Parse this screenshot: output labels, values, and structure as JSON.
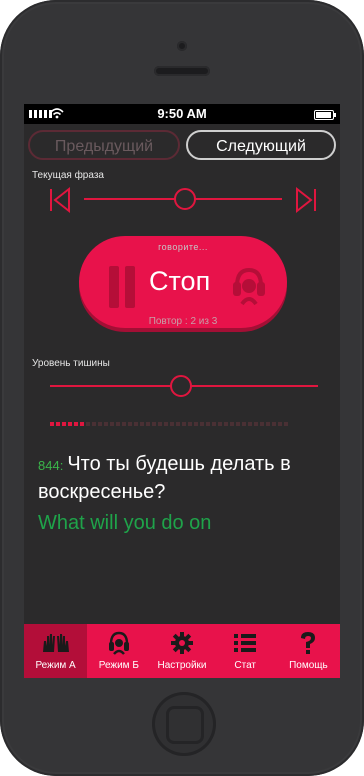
{
  "status_bar": {
    "time": "9:50 AM"
  },
  "nav": {
    "prev_label": "Предыдущий",
    "next_label": "Следующий"
  },
  "current_phrase": {
    "label": "Текущая фраза",
    "position": 0.51
  },
  "player": {
    "speaking_label": "говорите...",
    "stop_label": "Стоп",
    "repeat_label": "Повтор : 2 из 3"
  },
  "silence": {
    "label": "Уровень тишины",
    "level": 0.49
  },
  "progress": {
    "filled": 6,
    "total": 40
  },
  "phrase": {
    "number": "844:",
    "text": "Что ты будешь делать в воскресенье?",
    "translation": "What will you do on"
  },
  "tabs": [
    {
      "label": "Режим А",
      "icon": "hands-icon",
      "active": true
    },
    {
      "label": "Режим Б",
      "icon": "headphones-icon",
      "active": false
    },
    {
      "label": "Настройки",
      "icon": "gear-icon",
      "active": false
    },
    {
      "label": "Стат",
      "icon": "list-icon",
      "active": false
    },
    {
      "label": "Помощь",
      "icon": "question-icon",
      "active": false
    }
  ],
  "colors": {
    "accent": "#e8124b",
    "accent_dark": "#b30e39",
    "screen_bg": "#2b2a2b",
    "translation": "#1fa34a"
  }
}
